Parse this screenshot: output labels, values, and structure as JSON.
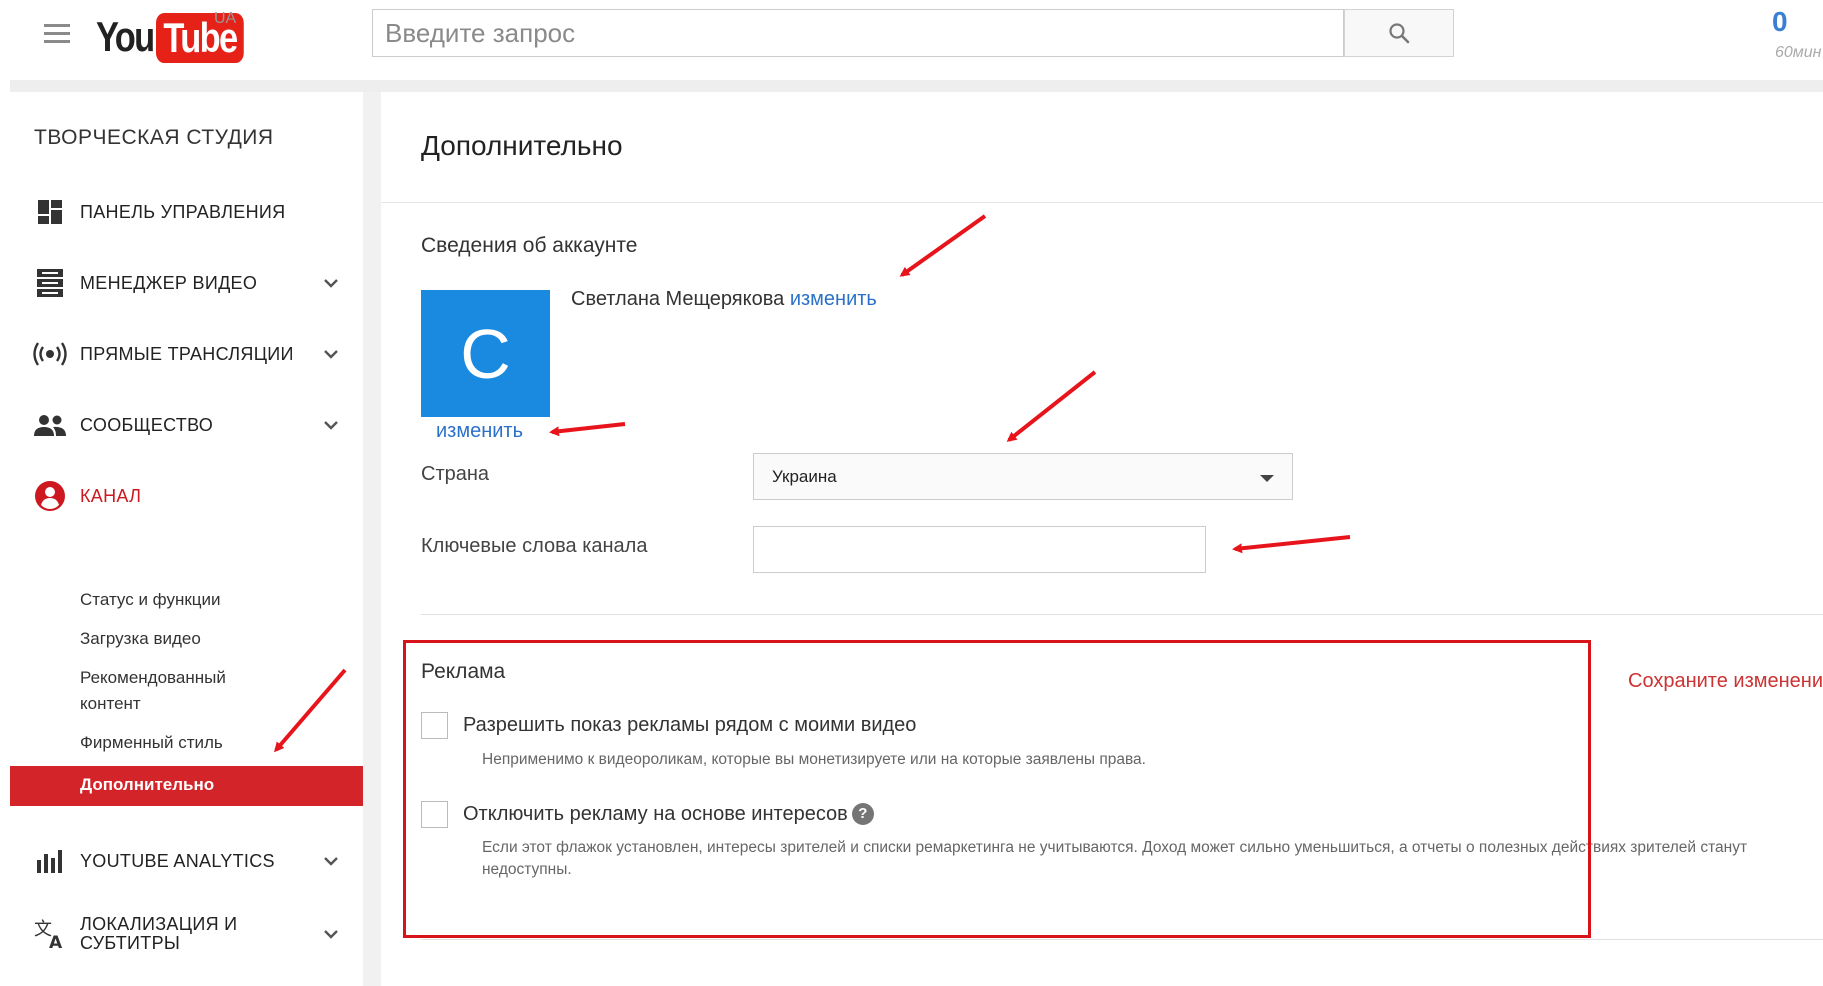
{
  "header": {
    "logo_you": "You",
    "logo_tube": "Tube",
    "logo_region": "UA",
    "search_placeholder": "Введите запрос",
    "count": "0",
    "count_sub": "60мин"
  },
  "sidebar": {
    "title": "ТВОРЧЕСКАЯ СТУДИЯ",
    "items": [
      {
        "label": "ПАНЕЛЬ УПРАВЛЕНИЯ",
        "icon": "dashboard-icon"
      },
      {
        "label": "МЕНЕДЖЕР ВИДЕО",
        "icon": "video-manager-icon"
      },
      {
        "label": "ПРЯМЫЕ ТРАНСЛЯЦИИ",
        "icon": "live-stream-icon"
      },
      {
        "label": "СООБЩЕСТВО",
        "icon": "community-icon"
      },
      {
        "label": "КАНАЛ",
        "icon": "channel-icon"
      },
      {
        "label": "YOUTUBE ANALYTICS",
        "icon": "analytics-icon"
      },
      {
        "label_line1": "ЛОКАЛИЗАЦИЯ И",
        "label_line2": "СУБТИТРЫ",
        "icon": "translate-icon"
      }
    ],
    "channel_sub": [
      {
        "label": "Статус и функции"
      },
      {
        "label": "Загрузка видео"
      },
      {
        "label_line1": "Рекомендованный",
        "label_line2": "контент"
      },
      {
        "label": "Фирменный стиль"
      },
      {
        "label": "Дополнительно"
      }
    ],
    "active_color": "#cc181e",
    "selected_bg": "#d3242a"
  },
  "main": {
    "title": "Дополнительно",
    "account": {
      "heading": "Сведения об аккаунте",
      "avatar_letter": "C",
      "avatar_color": "#1a8ae0",
      "avatar_change": "изменить",
      "name": "Светлана Мещерякова",
      "name_change": "изменить"
    },
    "country": {
      "label": "Страна",
      "value": "Украина"
    },
    "keywords": {
      "label": "Ключевые слова канала",
      "value": ""
    },
    "ads": {
      "heading": "Реклама",
      "save_message": "Сохраните изменения",
      "option1": {
        "label": "Разрешить показ рекламы рядом с моими видео",
        "desc": "Неприменимо к видеороликам, которые вы монетизируете или на которые заявлены права."
      },
      "option2": {
        "label": "Отключить рекламу на основе интересов",
        "help": "?",
        "desc": "Если этот флажок установлен, интересы зрителей и списки ремаркетинга не учитываются. Доход может сильно уменьшиться, а отчеты о полезных действиях зрителей станут недоступны."
      }
    }
  },
  "annotation_color": "#e8141c"
}
